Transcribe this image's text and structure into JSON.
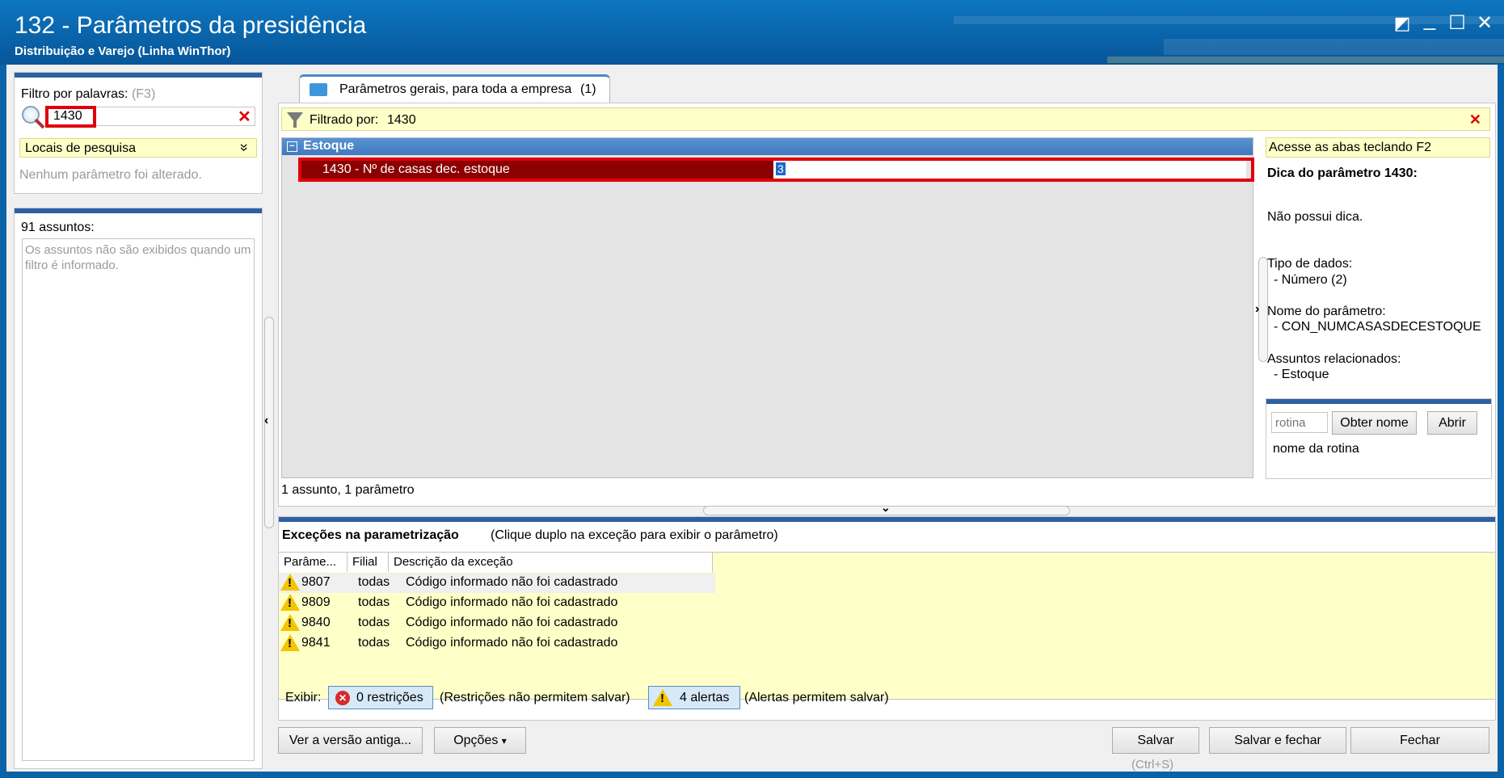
{
  "window": {
    "title": "132 - Parâmetros da presidência",
    "subtitle": "Distribuição e Varejo (Linha WinThor)",
    "controls": [
      "◩",
      "_",
      "☐",
      "✕"
    ]
  },
  "filter_panel": {
    "label": "Filtro por palavras:",
    "shortcut": "(F3)",
    "search_value": "1430",
    "clear_glyph": "✕",
    "locations_label": "Locais de pesquisa",
    "locations_chevron": "»",
    "status_text": "Nenhum parâmetro foi alterado."
  },
  "subjects_panel": {
    "label": "91 assuntos:",
    "message": "Os assuntos não são exibidos quando um filtro é informado."
  },
  "tab": {
    "label": "Parâmetros gerais, para toda a empresa",
    "count": "(1)"
  },
  "filter_bar": {
    "label": "Filtrado por:",
    "value": "1430",
    "close_glyph": "✕"
  },
  "tree": {
    "group_toggle": "−",
    "group": "Estoque",
    "param_label": "1430 - Nº de casas dec. estoque",
    "param_value": "3",
    "summary": "1 assunto, 1 parâmetro"
  },
  "hint_panel": {
    "shortcut_hint": "Acesse as abas teclando F2",
    "title": "Dica do parâmetro 1430:",
    "no_hint": "Não possui dica.",
    "data_type_label": "Tipo de dados:",
    "data_type_value": "- Número (2)",
    "param_name_label": "Nome do parâmetro:",
    "param_name_value": "- CON_NUMCASASDECESTOQUE",
    "related_label": "Assuntos relacionados:",
    "related_value": "- Estoque",
    "routine_placeholder": "rotina",
    "get_name_button": "Obter nome",
    "open_button": "Abrir",
    "routine_name": "nome da rotina"
  },
  "exceptions": {
    "title": "Exceções na parametrização",
    "hint": "(Clique duplo na exceção para exibir o parâmetro)",
    "columns": [
      "Parâme...",
      "Filial",
      "Descrição da exceção"
    ],
    "rows": [
      {
        "param": "9807",
        "filial": "todas",
        "descricao": "Código informado não foi cadastrado"
      },
      {
        "param": "9809",
        "filial": "todas",
        "descricao": "Código informado não foi cadastrado"
      },
      {
        "param": "9840",
        "filial": "todas",
        "descricao": "Código informado não foi cadastrado"
      },
      {
        "param": "9841",
        "filial": "todas",
        "descricao": "Código informado não foi cadastrado"
      }
    ],
    "show_label": "Exibir:",
    "restrictions_button": "0 restrições",
    "restrictions_note": "(Restrições não permitem salvar)",
    "alerts_button": "4 alertas",
    "alerts_note": "(Alertas permitem salvar)"
  },
  "footer": {
    "old_version_button": "Ver a versão antiga...",
    "options_button": "Opções",
    "options_caret": "▾",
    "save_button": "Salvar",
    "save_shortcut": "(Ctrl+S)",
    "save_close_button": "Salvar e fechar",
    "close_button": "Fechar"
  },
  "colors": {
    "titlebar": "#0a64aa",
    "panel_accent": "#2e5fa3",
    "selected_row": "#8b0000",
    "highlight_box": "#e0000b",
    "yellow_background": "#ffffc8",
    "group_header": "#4f86c6"
  }
}
